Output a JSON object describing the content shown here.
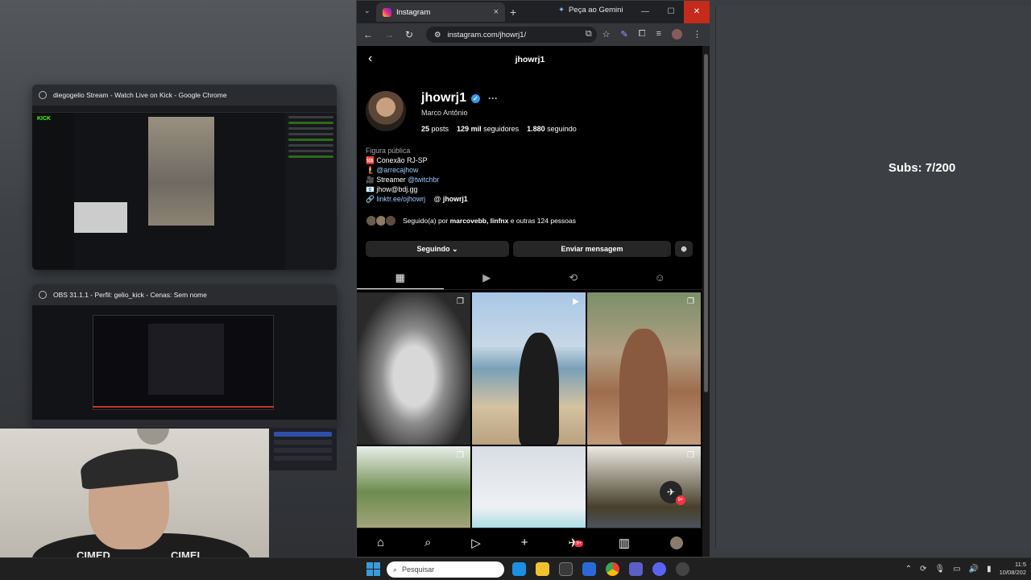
{
  "overlay": {
    "subs": "Subs: 7/200"
  },
  "taskview": {
    "window1_title": "diegogelio Stream - Watch Live on Kick - Google Chrome",
    "window1_logo": "KICK",
    "window2_title": "OBS 31.1.1 - Perfil: gelio_kick - Cenas: Sem nome",
    "webcam_shirt_left": "CIMED",
    "webcam_shirt_right": "CIMEI"
  },
  "browser": {
    "tab_title": "Instagram",
    "gemini_label": "Peça ao Gemini",
    "url": "instagram.com/jhowrj1/",
    "new_tab": "+",
    "close_tab": "×"
  },
  "profile": {
    "header_title": "jhowrj1",
    "username": "jhowrj1",
    "full_name": "Marco Antônio",
    "posts": "25",
    "posts_label": "posts",
    "followers": "129 mil",
    "followers_label": "seguidores",
    "following": "1.880",
    "following_label": "seguindo",
    "category": "Figura pública",
    "bio_lines": [
      {
        "icon": "🆘",
        "text": "Conexão RJ-SP"
      },
      {
        "icon": "🧜",
        "text": "@arrecajhow"
      },
      {
        "icon": "🎥",
        "text": "Streamer",
        "mention": "@twitchbr"
      },
      {
        "icon": "📧",
        "text": "jhow@bdj.gg"
      }
    ],
    "link": "linktr.ee/ojhowrj",
    "threads": "jhowrj1",
    "followed_by_prefix": "Seguido(a) por",
    "followed_by_names": "marcovebb, linfnx",
    "followed_by_suffix": "e outras 124 pessoas",
    "following_button": "Seguindo",
    "message_button": "Enviar mensagem",
    "message_badge": "9+",
    "nav_badge": "9+"
  },
  "taskbar": {
    "search_placeholder": "Pesquisar",
    "time": "11:5",
    "date": "10/08/202"
  },
  "icons": {
    "back": "arrow-left-icon",
    "verified": "verified-badge-icon",
    "grid": "grid-icon",
    "reels": "reels-icon",
    "reposts": "repost-icon",
    "tagged": "tagged-icon"
  },
  "colors": {
    "instagram_bg": "#000000",
    "link_blue": "#9ccbff",
    "verified_blue": "#3897f0",
    "close_red": "#c42b1c"
  }
}
